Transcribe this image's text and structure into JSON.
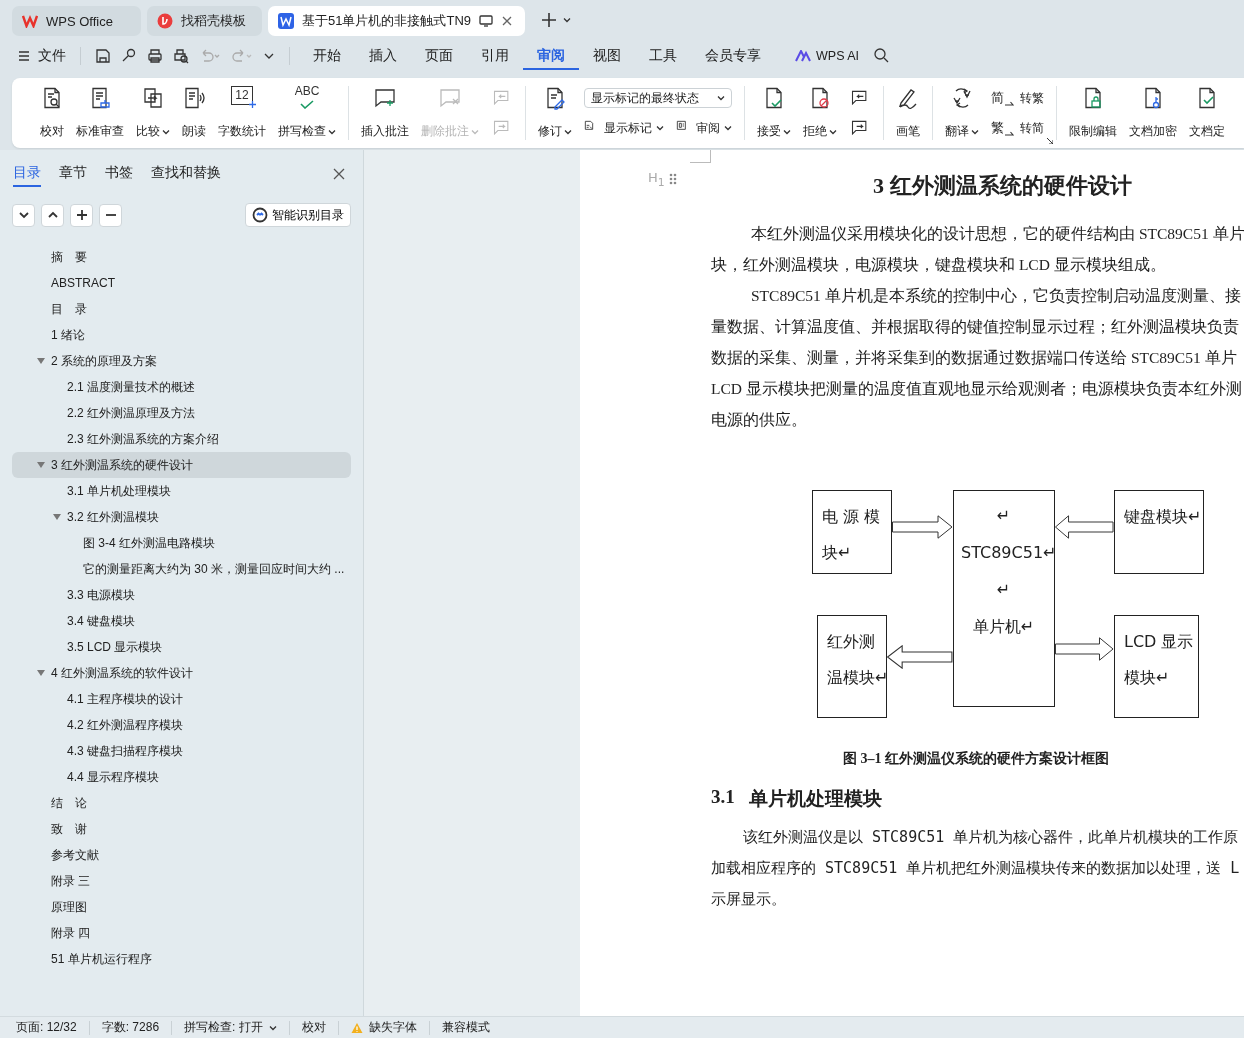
{
  "tabs": [
    {
      "kind": "home",
      "label": "WPS Office",
      "selected": false
    },
    {
      "kind": "template",
      "label": "找稻壳模板",
      "selected": false
    },
    {
      "kind": "document",
      "label": "基于51单片机的非接触式TN9",
      "selected": true
    }
  ],
  "menu": {
    "file": "文件",
    "tabs": [
      {
        "label": "开始",
        "selected": false
      },
      {
        "label": "插入",
        "selected": false
      },
      {
        "label": "页面",
        "selected": false
      },
      {
        "label": "引用",
        "selected": false
      },
      {
        "label": "审阅",
        "selected": true
      },
      {
        "label": "视图",
        "selected": false
      },
      {
        "label": "工具",
        "selected": false
      },
      {
        "label": "会员专享",
        "selected": false
      }
    ],
    "ai": "WPS AI"
  },
  "ribbon": {
    "groups": [
      {
        "items": [
          {
            "kind": "large",
            "label": "校对",
            "dropdown": false,
            "disabled": false
          },
          {
            "kind": "large",
            "label": "标准审查",
            "dropdown": false,
            "disabled": false
          },
          {
            "kind": "large",
            "label": "比较",
            "dropdown": true,
            "disabled": false
          },
          {
            "kind": "large",
            "label": "朗读",
            "dropdown": false,
            "disabled": false
          },
          {
            "kind": "large",
            "label": "字数统计",
            "icon_text": "12",
            "dropdown": false,
            "disabled": false
          },
          {
            "kind": "large",
            "label": "拼写检查",
            "icon_text": "ABC",
            "dropdown": true,
            "disabled": false
          }
        ]
      },
      {
        "items": [
          {
            "kind": "large",
            "label": "插入批注",
            "dropdown": false,
            "disabled": false
          },
          {
            "kind": "large",
            "label": "删除批注",
            "dropdown": true,
            "disabled": true
          },
          {
            "kind": "stack",
            "rows": [
              [
                {
                  "kind": "small",
                  "disabled": true
                }
              ],
              [
                {
                  "kind": "small",
                  "disabled": true
                }
              ]
            ]
          }
        ]
      },
      {
        "items": [
          {
            "kind": "large",
            "label": "修订",
            "dropdown": true,
            "disabled": false
          },
          {
            "kind": "stack",
            "rows": [
              [
                {
                  "kind": "combo",
                  "value": "显示标记的最终状态",
                  "disabled": false
                }
              ],
              [
                {
                  "kind": "inline",
                  "label": "显示标记",
                  "dropdown": true,
                  "disabled": false
                },
                {
                  "kind": "inline",
                  "label": "审阅",
                  "dropdown": true,
                  "disabled": false
                }
              ]
            ]
          }
        ]
      },
      {
        "items": [
          {
            "kind": "large",
            "label": "接受",
            "dropdown": true,
            "disabled": false
          },
          {
            "kind": "large",
            "label": "拒绝",
            "dropdown": true,
            "disabled": false
          },
          {
            "kind": "stack",
            "rows": [
              [
                {
                  "kind": "small",
                  "disabled": false
                }
              ],
              [
                {
                  "kind": "small",
                  "disabled": false
                }
              ]
            ]
          }
        ]
      },
      {
        "items": [
          {
            "kind": "large",
            "label": "画笔",
            "dropdown": false,
            "disabled": false
          }
        ]
      },
      {
        "items": [
          {
            "kind": "large",
            "label": "翻译",
            "dropdown": true,
            "disabled": false
          },
          {
            "kind": "stack",
            "rows": [
              [
                {
                  "kind": "inline",
                  "icon_text": "简",
                  "label": "转繁",
                  "dropdown": false,
                  "disabled": false
                }
              ],
              [
                {
                  "kind": "inline",
                  "icon_text": "繁",
                  "label": "转简",
                  "dropdown": false,
                  "disabled": false
                }
              ]
            ]
          }
        ]
      },
      {
        "items": [
          {
            "kind": "large",
            "label": "限制编辑",
            "dropdown": false,
            "disabled": false
          },
          {
            "kind": "large",
            "label": "文档加密",
            "dropdown": false,
            "disabled": false
          },
          {
            "kind": "large",
            "label": "文档定",
            "dropdown": false,
            "disabled": false
          }
        ]
      }
    ]
  },
  "sidebar": {
    "tabs": [
      {
        "label": "目录",
        "selected": true
      },
      {
        "label": "章节",
        "selected": false
      },
      {
        "label": "书签",
        "selected": false
      },
      {
        "label": "查找和替换",
        "selected": false
      }
    ],
    "smart_button": "智能识别目录",
    "outline": [
      {
        "label": "摘　要",
        "selected": false
      },
      {
        "label": "ABSTRACT",
        "selected": false
      },
      {
        "label": "目　录",
        "selected": false
      },
      {
        "label": "1 绪论",
        "selected": false
      },
      {
        "label": "2  系统的原理及方案",
        "selected": false,
        "expanded": true,
        "children": [
          {
            "label": "2.1 温度测量技术的概述",
            "selected": false
          },
          {
            "label": "2.2  红外测温原理及方法",
            "selected": false
          },
          {
            "label": "2.3  红外测温系统的方案介绍",
            "selected": false
          }
        ]
      },
      {
        "label": "3  红外测温系统的硬件设计",
        "selected": true,
        "expanded": true,
        "children": [
          {
            "label": "3.1  单片机处理模块",
            "selected": false
          },
          {
            "label": "3.2  红外测温模块",
            "selected": false,
            "expanded": true,
            "children": [
              {
                "label": "图 3-4  红外测温电路模块",
                "selected": false
              },
              {
                "label": "它的测量距离大约为 30 米，测量回应时间大约 ...",
                "selected": false
              }
            ]
          },
          {
            "label": "3.3  电源模块",
            "selected": false
          },
          {
            "label": "3.4  键盘模块",
            "selected": false
          },
          {
            "label": "3.5 LCD 显示模块",
            "selected": false
          }
        ]
      },
      {
        "label": "4  红外测温系统的软件设计",
        "selected": false,
        "expanded": true,
        "children": [
          {
            "label": "4.1  主程序模块的设计",
            "selected": false
          },
          {
            "label": "4.2  红外测温程序模块",
            "selected": false
          },
          {
            "label": "4.3  键盘扫描程序模块",
            "selected": false
          },
          {
            "label": "4.4  显示程序模块",
            "selected": false
          }
        ]
      },
      {
        "label": "结　论",
        "selected": false
      },
      {
        "label": "致　谢",
        "selected": false
      },
      {
        "label": "参考文献",
        "selected": false
      },
      {
        "label": "附录 三",
        "selected": false
      },
      {
        "label": "原理图",
        "selected": false
      },
      {
        "label": "附录 四",
        "selected": false
      },
      {
        "label": "51 单片机运行程序",
        "selected": false
      }
    ]
  },
  "document": {
    "heading_marker": "H$_{1}$",
    "heading": "3  红外测温系统的硬件设计",
    "paragraphs": [
      {
        "lines": [
          "本红外测温仪采用模块化的设计思想，它的硬件结构由 STC89C51 单片",
          "块，红外测温模块，电源模块，键盘模块和 LCD 显示模块组成。"
        ]
      },
      {
        "lines": [
          "STC89C51 单片机是本系统的控制中心，它负责控制启动温度测量、接",
          "量数据、计算温度值、并根据取得的键值控制显示过程；红外测温模块负责",
          "数据的采集、测量，并将采集到的数据通过数据端口传送给 STC89C51 单片",
          "LCD 显示模块把测量的温度值直观地显示给观测者；电源模块负责本红外测",
          "电源的供应。"
        ]
      }
    ],
    "diagram": {
      "blocks": [
        {
          "lines": [
            "电 源 模",
            "块↵"
          ]
        },
        {
          "lines": [
            "↵",
            "STC89C51↵",
            "↵",
            "单片机↵"
          ]
        },
        {
          "lines": [
            "键盘模块↵"
          ]
        },
        {
          "lines": [
            "红外测",
            "温模块↵"
          ]
        },
        {
          "lines": [
            "LCD 显示",
            "模块↵"
          ]
        }
      ]
    },
    "caption": "图 3–1 红外测温仪系统的硬件方案设计框图",
    "subheading": {
      "number": "3.1",
      "title": "单片机处理模块"
    },
    "paragraphs_2": [
      {
        "lines": [
          "该红外测温仪是以 STC89C51 单片机为核心器件，此单片机模块的工作原",
          "加载相应程序的 STC89C51 单片机把红外测温模块传来的数据加以处理，送 L",
          "示屏显示。"
        ]
      }
    ]
  },
  "status_bar": [
    {
      "kind": "text",
      "label": "页面: 12/32"
    },
    {
      "kind": "text",
      "label": "字数: 7286"
    },
    {
      "kind": "dropdown",
      "label": "拼写检查: 打开"
    },
    {
      "kind": "text",
      "label": "校对"
    },
    {
      "kind": "warning",
      "label": "缺失字体"
    },
    {
      "kind": "text",
      "label": "兼容模式"
    }
  ]
}
